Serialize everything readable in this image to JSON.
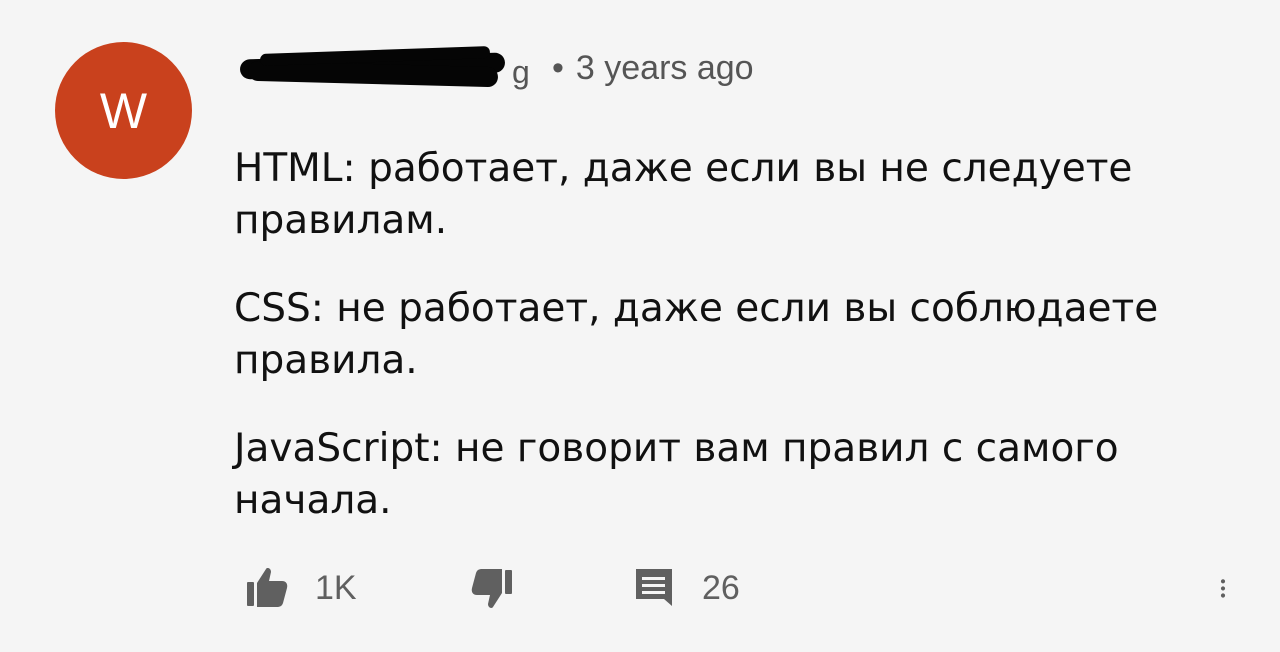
{
  "header": {
    "avatar_letter": "W",
    "visible_name_fragment": "g",
    "separator": "•",
    "timestamp": "3 years ago"
  },
  "comment": {
    "paragraphs": [
      "HTML: работает, даже если вы не следуете правилам.",
      "CSS: не работает, даже если вы соблюдаете правила.",
      "JavaScript: не говорит вам правил с самого начала."
    ]
  },
  "actions": {
    "like_icon": "thumbs-up-icon",
    "like_count": "1K",
    "dislike_icon": "thumbs-down-icon",
    "reply_icon": "comment-icon",
    "reply_count": "26",
    "menu_icon": "more-vertical-icon"
  },
  "colors": {
    "background": "#f5f5f5",
    "avatar": "#c9411d",
    "text": "#111111",
    "muted": "#606060"
  }
}
